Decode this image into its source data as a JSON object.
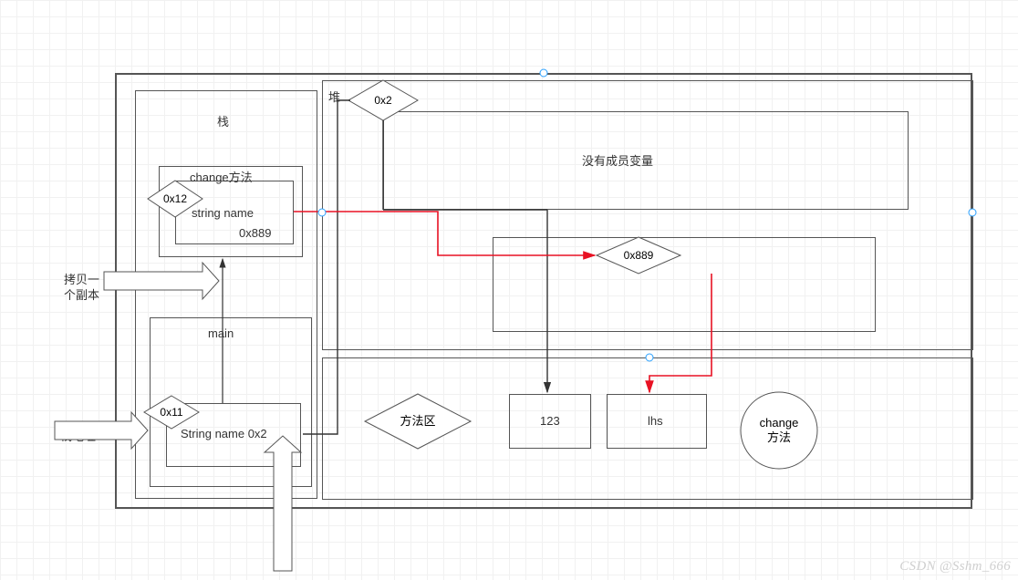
{
  "labels": {
    "stack_title": "栈",
    "heap_label": "堆",
    "change_method": "change方法",
    "string_name_889_line1": "string name",
    "string_name_889_line2": "0x889",
    "main_label": "main",
    "string_name_0x2": "String name 0x2",
    "addr_0x12": "0x12",
    "addr_0x11": "0x11",
    "addr_0x2": "0x2",
    "addr_0x889": "0x889",
    "no_member_var": "没有成员变量",
    "method_area": "方法区",
    "val_123": "123",
    "val_lhs": "lhs",
    "change_circle_line1": "change",
    "change_circle_line2": "方法",
    "copy_text_line1": "拷贝一",
    "copy_text_line2": "个副本",
    "stack_addr": "栈地址",
    "watermark": "CSDN @Sshm_666"
  }
}
